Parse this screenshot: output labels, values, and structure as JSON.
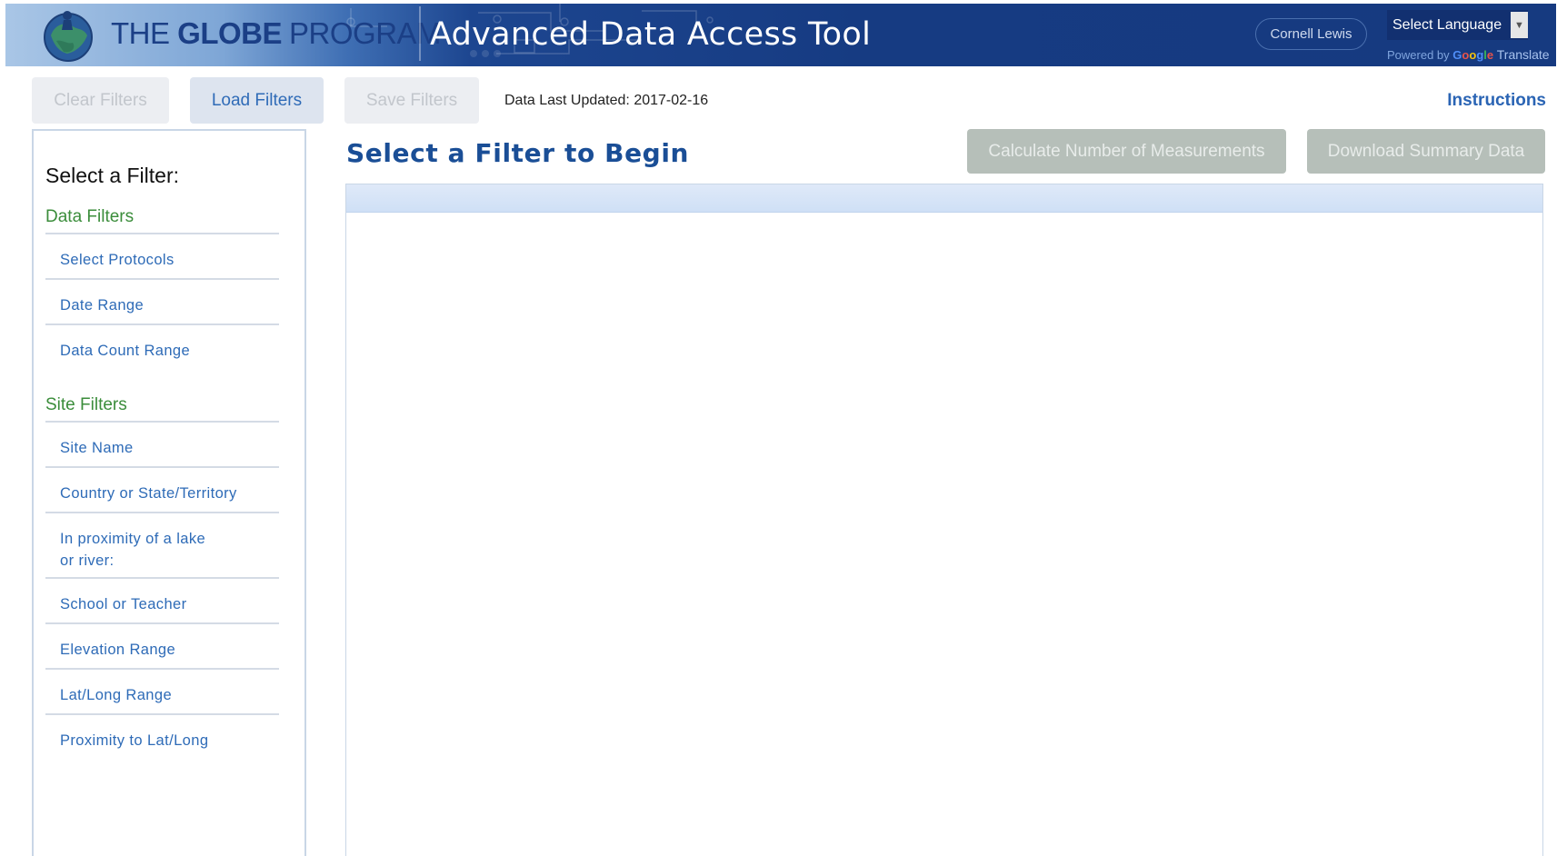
{
  "header": {
    "brand_the": "THE",
    "brand_globe": "GLOBE",
    "brand_program": "PROGRAM",
    "app_title": "Advanced Data Access Tool",
    "user_name": "Cornell Lewis",
    "language_select": "Select Language",
    "powered_by": "Powered by",
    "google": "Google",
    "translate": "Translate"
  },
  "toolbar": {
    "clear_filters": "Clear Filters",
    "load_filters": "Load Filters",
    "save_filters": "Save Filters",
    "last_updated": "Data Last Updated: 2017-02-16",
    "instructions": "Instructions"
  },
  "sidebar": {
    "title": "Select a Filter:",
    "data_filters_label": "Data Filters",
    "data_filters": [
      "Select Protocols",
      "Date Range",
      "Data Count Range"
    ],
    "site_filters_label": "Site Filters",
    "site_filters": [
      "Site Name",
      "Country or State/Territory",
      "In proximity of a lake or river:",
      "School or Teacher",
      "Elevation Range",
      "Lat/Long Range",
      "Proximity to Lat/Long"
    ]
  },
  "main": {
    "title": "Select a Filter to Begin",
    "calculate_button": "Calculate Number of Measurements",
    "download_button": "Download Summary Data"
  },
  "colors": {
    "header_bg": "#163a80",
    "link_blue": "#2e6bb7",
    "group_green": "#3b8d3b",
    "title_blue": "#1a4e96",
    "disabled_button": "#b6bfb9"
  }
}
